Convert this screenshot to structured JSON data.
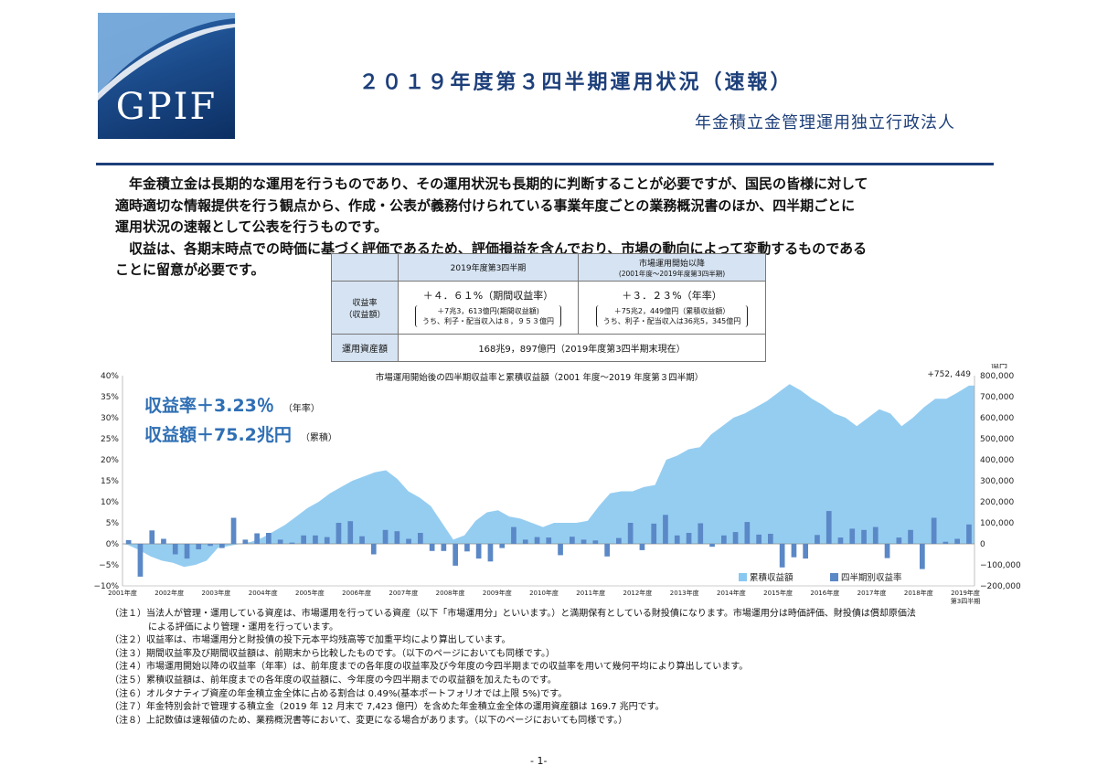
{
  "logo": {
    "text": "GPIF"
  },
  "title": "２０１９年度第３四半期運用状況（速報）",
  "organization": "年金積立金管理運用独立行政法人",
  "intro": {
    "p1": [
      "年金積立金は長期的な運用を行うものであり、その運用状況も長期的に判断することが必要ですが、国民の皆様に対して",
      "適時適切な情報提供を行う観点から、作成・公表が義務付けられている事業年度ごとの業務概況書のほか、四半期ごとに",
      "運用状況の速報として公表を行うものです。"
    ],
    "p2": [
      "収益は、各期末時点での時価に基づく評価であるため、評価損益を含んでおり、市場の動向によって変動するものである",
      "ことに留意が必要です。"
    ]
  },
  "summary_table": {
    "col1_header": "2019年度第3四半期",
    "col2_header_line1": "市場運用開始以降",
    "col2_header_line2": "(2001年度～2019年度第3四半期)",
    "row1_label_line1": "収益率",
    "row1_label_line2": "（収益額）",
    "col1_rate": "＋４．６１%（期間収益率）",
    "col1_amount": "＋7兆3，613億円(期間収益額)",
    "col1_interest": "うち、利子・配当収入は８，９５３億円",
    "col2_rate": "＋３．２３%（年率）",
    "col2_amount": "＋75兆2，449億円（累積収益額）",
    "col2_interest": "うち、利子・配当収入は36兆5，345億円",
    "row2_label": "運用資産額",
    "assets": "168兆9，897億円（2019年度第3四半期末現在）"
  },
  "chart_overlay": {
    "rate_label": "収益率",
    "rate_value": "＋3.23％",
    "rate_note": "（年率）",
    "amount_label": "収益額",
    "amount_value": "＋75.2兆円",
    "amount_note": "（累積）"
  },
  "chart_data": {
    "type": "bar+area",
    "title": "市場運用開始後の四半期収益率と累積収益額（2001 年度～2019 年度第３四半期）",
    "left_axis": {
      "ticks": [
        "40%",
        "35%",
        "30%",
        "25%",
        "20%",
        "15%",
        "10%",
        "5%",
        "0%",
        "−5%",
        "−10%"
      ],
      "range": [
        -10,
        40
      ]
    },
    "right_axis": {
      "unit": "億円",
      "ticks": [
        "800,000",
        "700,000",
        "600,000",
        "500,000",
        "400,000",
        "300,000",
        "200,000",
        "100,000",
        "0",
        "−100,000",
        "−200,000"
      ],
      "range": [
        -200000,
        800000
      ]
    },
    "x_labels": [
      "2001年度",
      "2002年度",
      "2003年度",
      "2004年度",
      "2005年度",
      "2006年度",
      "2007年度",
      "2008年度",
      "2009年度",
      "2010年度",
      "2011年度",
      "2012年度",
      "2013年度",
      "2014年度",
      "2015年度",
      "2016年度",
      "2017年度",
      "2018年度",
      "2019年度"
    ],
    "x_last_sublabel": "第3四半期",
    "end_label": "+752, 449",
    "series": [
      {
        "name": "累積収益額",
        "color": "#89c8f0",
        "values": [
          -5000,
          -30000,
          -60000,
          -80000,
          -90000,
          -110000,
          -100000,
          -80000,
          -20000,
          -10000,
          0,
          10000,
          30000,
          60000,
          90000,
          130000,
          170000,
          200000,
          240000,
          270000,
          300000,
          320000,
          340000,
          350000,
          310000,
          250000,
          220000,
          180000,
          100000,
          20000,
          40000,
          110000,
          150000,
          160000,
          130000,
          120000,
          100000,
          80000,
          100000,
          100000,
          100000,
          110000,
          180000,
          240000,
          250000,
          250000,
          270000,
          280000,
          400000,
          420000,
          450000,
          460000,
          520000,
          560000,
          600000,
          620000,
          650000,
          680000,
          720000,
          760000,
          730000,
          690000,
          660000,
          620000,
          600000,
          560000,
          600000,
          640000,
          620000,
          560000,
          600000,
          650000,
          690000,
          690000,
          720000,
          752449
        ]
      },
      {
        "name": "四半期別収益率",
        "color": "#5b88c6",
        "values": [
          0.9,
          -7.8,
          3.2,
          1.2,
          -2.5,
          -3.5,
          -1.3,
          -0.5,
          -1.0,
          6.2,
          1.0,
          2.5,
          2.6,
          1.0,
          0.3,
          2.0,
          2.0,
          1.6,
          5.0,
          5.4,
          1.8,
          -2.5,
          3.3,
          3.0,
          1.2,
          2.6,
          -1.7,
          -1.7,
          -5.2,
          -1.8,
          -3.5,
          -4.2,
          -1.0,
          4.0,
          1.0,
          1.6,
          1.5,
          -2.7,
          1.7,
          1.0,
          0.8,
          -3.0,
          1.4,
          5.0,
          -1.5,
          4.8,
          6.9,
          2.0,
          2.6,
          4.9,
          -0.7,
          2.0,
          2.8,
          5.2,
          2.2,
          2.4,
          -5.6,
          -3.2,
          -3.5,
          2.1,
          7.8,
          1.5,
          3.6,
          3.3,
          4.0,
          -3.4,
          1.5,
          3.3,
          -6.0,
          6.2,
          0.5,
          1.2,
          4.6
        ]
      }
    ]
  },
  "legend": {
    "cumulative": "累積収益額",
    "quarterly": "四半期別収益率"
  },
  "notes": [
    {
      "tag": "（注１）",
      "text": "当法人が管理・運用している資産は、市場運用を行っている資産（以下「市場運用分」といいます。）と満期保有としている財投債になります。市場運用分は時価評価、財投債は償却原価法"
    },
    {
      "tag": "",
      "text": "による評価により管理・運用を行っています。"
    },
    {
      "tag": "（注２）",
      "text": "収益率は、市場運用分と財投債の投下元本平均残高等で加重平均により算出しています。"
    },
    {
      "tag": "（注３）",
      "text": "期間収益率及び期間収益額は、前期末から比較したものです。（以下のページにおいても同様です。）"
    },
    {
      "tag": "（注４）",
      "text": "市場運用開始以降の収益率（年率）は、前年度までの各年度の収益率及び今年度の今四半期までの収益率を用いて幾何平均により算出しています。"
    },
    {
      "tag": "（注５）",
      "text": "累積収益額は、前年度までの各年度の収益額に、今年度の今四半期までの収益額を加えたものです。"
    },
    {
      "tag": "（注６）",
      "text": "オルタナティブ資産の年金積立金全体に占める割合は 0.49%(基本ポートフォリオでは上限 5%)です。"
    },
    {
      "tag": "（注７）",
      "text": "年金特別会計で管理する積立金（2019 年 12 月末で 7,423 億円）を含めた年金積立金全体の運用資産額は 169.7 兆円です。"
    },
    {
      "tag": "（注８）",
      "text": "上記数値は速報値のため、業務概況書等において、変更になる場合があります。（以下のページにおいても同様です。）"
    }
  ],
  "page_number": "- 1-"
}
